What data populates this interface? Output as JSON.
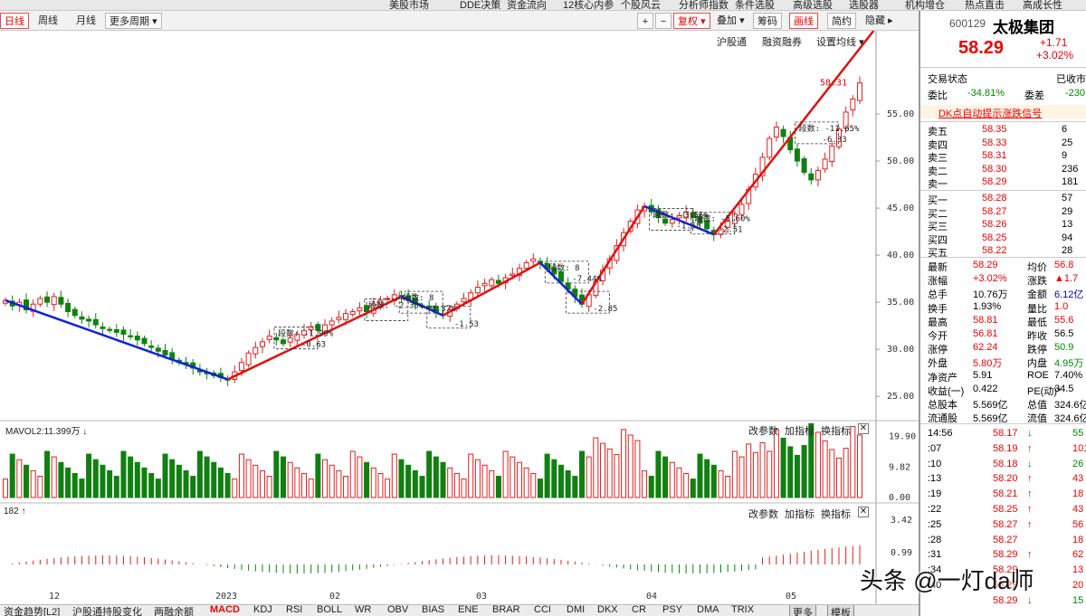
{
  "top_menu": [
    "美股市场",
    "DDE决策",
    "资金流向",
    "12核心内参",
    "个股风云",
    "分析师指数",
    "条件选股",
    "高级选股",
    "选股器",
    "机构增仓",
    "热点直击",
    "高成长性"
  ],
  "toolbar": {
    "left": [
      "日线",
      "周线",
      "月线",
      "更多周期"
    ],
    "right": [
      "复权",
      "叠加",
      "筹码",
      "画线",
      "简约",
      "隐藏"
    ]
  },
  "main_links": [
    "沪股通",
    "融资融券",
    "设置均线"
  ],
  "price_axis": [
    "55.00",
    "50.00",
    "45.00",
    "40.00",
    "35.00",
    "30.00",
    "25.00"
  ],
  "price_marker": "58.31",
  "annotations": [
    {
      "label": "段数: -1.99%",
      "sub": "-0.63"
    },
    {
      "label": "段数: -2.38%",
      "sub": ""
    },
    {
      "label": "段数: 8",
      "sub": "-4.37%"
    },
    {
      "label": "",
      "sub": "-1.53"
    },
    {
      "label": "段数: 8",
      "sub": "-7.44%"
    },
    {
      "label": "",
      "sub": "-2.85"
    },
    {
      "label": "段数: -3.55%",
      "sub": "-1.58"
    },
    {
      "label": "段数: -5.60%",
      "sub": "-2.51"
    },
    {
      "label": "段数: -11.65%",
      "sub": "-6.33"
    }
  ],
  "volume_panel": {
    "label": "MAVOL2:11.399万 ↓",
    "actions": [
      "改参数",
      "加指标",
      "换指标"
    ],
    "axis": [
      "19.90",
      "9.82",
      "0.00"
    ]
  },
  "macd_panel": {
    "label": "182 ↑",
    "actions": [
      "改参数",
      "加指标",
      "换指标"
    ],
    "axis": [
      "3.42",
      "0.99"
    ]
  },
  "date_axis": [
    "12",
    "2023",
    "02",
    "03",
    "04",
    "05"
  ],
  "bottom_tabs": [
    "资金趋势[L2]",
    "沪股通持股变化",
    "两融余额",
    "MACD",
    "KDJ",
    "RSI",
    "BOLL",
    "WR",
    "OBV",
    "BIAS",
    "ENE",
    "BRAR",
    "CCI",
    "DMI",
    "DKX",
    "CR",
    "PSY",
    "DMA",
    "TRIX",
    "更多",
    "模板"
  ],
  "stock": {
    "code": "600129",
    "name": "太极集团",
    "price": "58.29",
    "change": "+1.71",
    "change_pct": "+3.02%"
  },
  "trade_status": {
    "label": "交易状态",
    "value": "已收市"
  },
  "order_ratio": {
    "wb_label": "委比",
    "wb": "-34.81%",
    "wc_label": "委差",
    "wc": "-230"
  },
  "signal": "DK点自动提示涨跌信号",
  "sell_orders": [
    {
      "label": "卖五",
      "price": "58.35",
      "vol": "6"
    },
    {
      "label": "卖四",
      "price": "58.33",
      "vol": "25"
    },
    {
      "label": "卖三",
      "price": "58.31",
      "vol": "9"
    },
    {
      "label": "卖二",
      "price": "58.30",
      "vol": "236"
    },
    {
      "label": "卖一",
      "price": "58.29",
      "vol": "181"
    }
  ],
  "buy_orders": [
    {
      "label": "买一",
      "price": "58.28",
      "vol": "57"
    },
    {
      "label": "买二",
      "price": "58.27",
      "vol": "29"
    },
    {
      "label": "买三",
      "price": "58.26",
      "vol": "13"
    },
    {
      "label": "买四",
      "price": "58.25",
      "vol": "94"
    },
    {
      "label": "买五",
      "price": "58.22",
      "vol": "28"
    }
  ],
  "stats": [
    {
      "l1": "最新",
      "v1": "58.29",
      "c1": "red",
      "l2": "均价",
      "v2": "56.8",
      "c2": "red"
    },
    {
      "l1": "涨幅",
      "v1": "+3.02%",
      "c1": "red",
      "l2": "涨跌",
      "v2": "▲1.7",
      "c2": "red"
    },
    {
      "l1": "总手",
      "v1": "10.76万",
      "c1": "",
      "l2": "金额",
      "v2": "6.12亿",
      "c2": "blue"
    },
    {
      "l1": "换手",
      "v1": "1.93%",
      "c1": "",
      "l2": "量比",
      "v2": "1.0",
      "c2": "red"
    },
    {
      "l1": "最高",
      "v1": "58.81",
      "c1": "red",
      "l2": "最低",
      "v2": "55.6",
      "c2": "red"
    },
    {
      "l1": "今开",
      "v1": "56.81",
      "c1": "red",
      "l2": "昨收",
      "v2": "56.5",
      "c2": ""
    },
    {
      "l1": "涨停",
      "v1": "62.24",
      "c1": "red",
      "l2": "跌停",
      "v2": "50.9",
      "c2": "green"
    },
    {
      "l1": "外盘",
      "v1": "5.80万",
      "c1": "red",
      "l2": "内盘",
      "v2": "4.95万",
      "c2": "green"
    },
    {
      "l1": "净资产",
      "v1": "5.91",
      "c1": "",
      "l2": "ROE",
      "v2": "7.40%",
      "c2": ""
    },
    {
      "l1": "收益(一)",
      "v1": "0.422",
      "c1": "",
      "l2": "PE(动)*",
      "v2": "34.5",
      "c2": ""
    },
    {
      "l1": "总股本",
      "v1": "5.569亿",
      "c1": "",
      "l2": "总值",
      "v2": "324.6亿",
      "c2": ""
    },
    {
      "l1": "流通股",
      "v1": "5.569亿",
      "c1": "",
      "l2": "流值",
      "v2": "324.6亿",
      "c2": ""
    }
  ],
  "ticks": [
    {
      "t": "14:56",
      "p": "58.17",
      "d": "↓",
      "v": "55",
      "c": "green"
    },
    {
      "t": ":07",
      "p": "58.19",
      "d": "↑",
      "v": "101",
      "c": "red"
    },
    {
      "t": ":10",
      "p": "58.18",
      "d": "↓",
      "v": "26",
      "c": "green"
    },
    {
      "t": ":13",
      "p": "58.20",
      "d": "↑",
      "v": "43",
      "c": "red"
    },
    {
      "t": ":19",
      "p": "58.21",
      "d": "↑",
      "v": "18",
      "c": "red"
    },
    {
      "t": ":22",
      "p": "58.25",
      "d": "↑",
      "v": "43",
      "c": "red"
    },
    {
      "t": ":25",
      "p": "58.27",
      "d": "↑",
      "v": "56",
      "c": "red"
    },
    {
      "t": ":28",
      "p": "58.27",
      "d": "",
      "v": "18",
      "c": "red"
    },
    {
      "t": ":31",
      "p": "58.29",
      "d": "↑",
      "v": "62",
      "c": "red"
    },
    {
      "t": ":34",
      "p": "58.29",
      "d": "",
      "v": "13",
      "c": "red"
    },
    {
      "t": ":40",
      "p": "58.29",
      "d": "",
      "v": "20",
      "c": "red"
    },
    {
      "t": "",
      "p": "58.29",
      "d": "↓",
      "v": "15",
      "c": "green"
    }
  ],
  "watermark": "头条 @一灯da师"
}
